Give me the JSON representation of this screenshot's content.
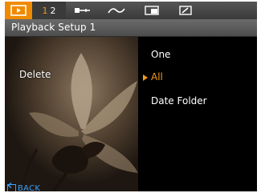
{
  "tabs": {
    "playback_icon": "playback-icon",
    "setup_page_1": "1",
    "setup_page_2": "2",
    "connect_icon": "connect-icon",
    "curve_icon": "curve-icon",
    "display_icon": "display-icon",
    "edit_icon": "edit-icon"
  },
  "header": {
    "title": "Playback Setup 1"
  },
  "left_panel": {
    "setting_label": "Delete",
    "back_label": "BACK",
    "back_icon": "back-icon"
  },
  "options": {
    "items": [
      "One",
      "All",
      "Date Folder"
    ],
    "selected": "All"
  },
  "colors": {
    "accent": "#f29a1a",
    "back_blue": "#3aa0ff",
    "playback_tab": "#f08a00"
  }
}
